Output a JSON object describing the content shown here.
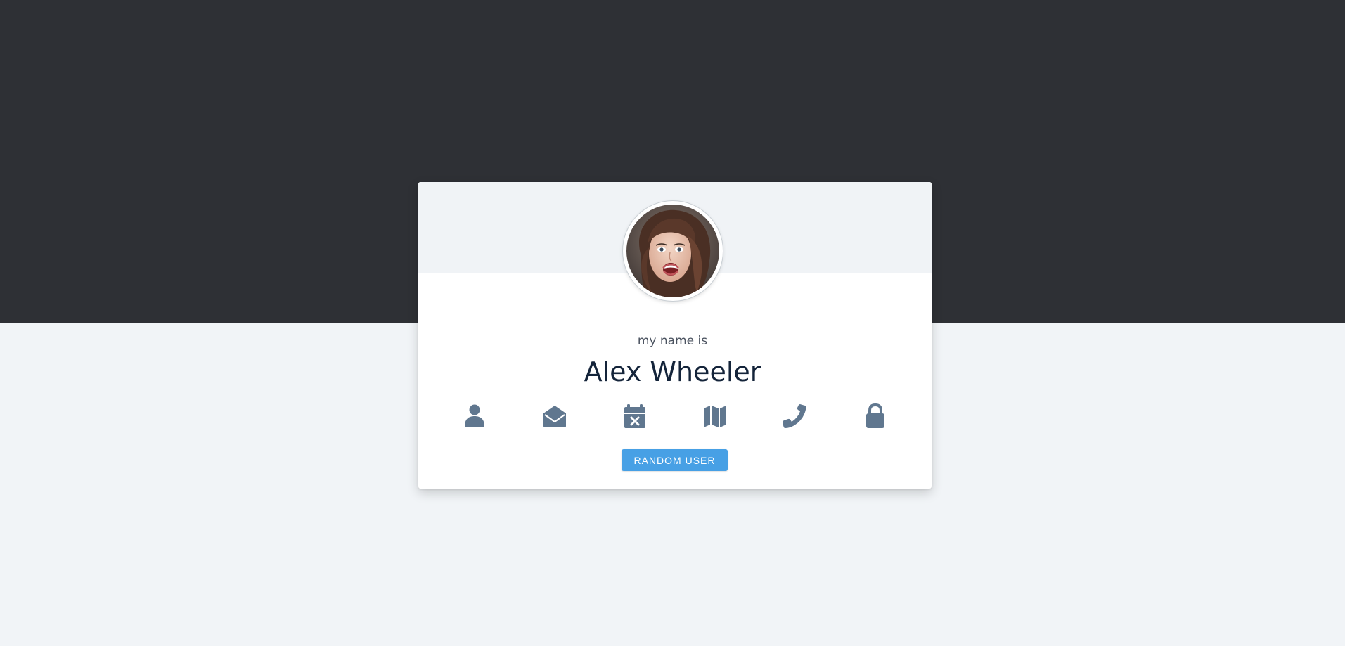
{
  "profile": {
    "subtitle": "my name is",
    "name": "Alex Wheeler"
  },
  "icons": [
    {
      "name": "user-icon"
    },
    {
      "name": "envelope-open-icon"
    },
    {
      "name": "calendar-x-icon"
    },
    {
      "name": "map-icon"
    },
    {
      "name": "phone-icon"
    },
    {
      "name": "lock-icon"
    }
  ],
  "actions": {
    "random_user_label": "RANDOM USER"
  },
  "colors": {
    "hero_background": "#2e3035",
    "page_background": "#f1f4f7",
    "icon": "#60778f",
    "button": "#47a0e5",
    "name_text": "#14243a"
  }
}
